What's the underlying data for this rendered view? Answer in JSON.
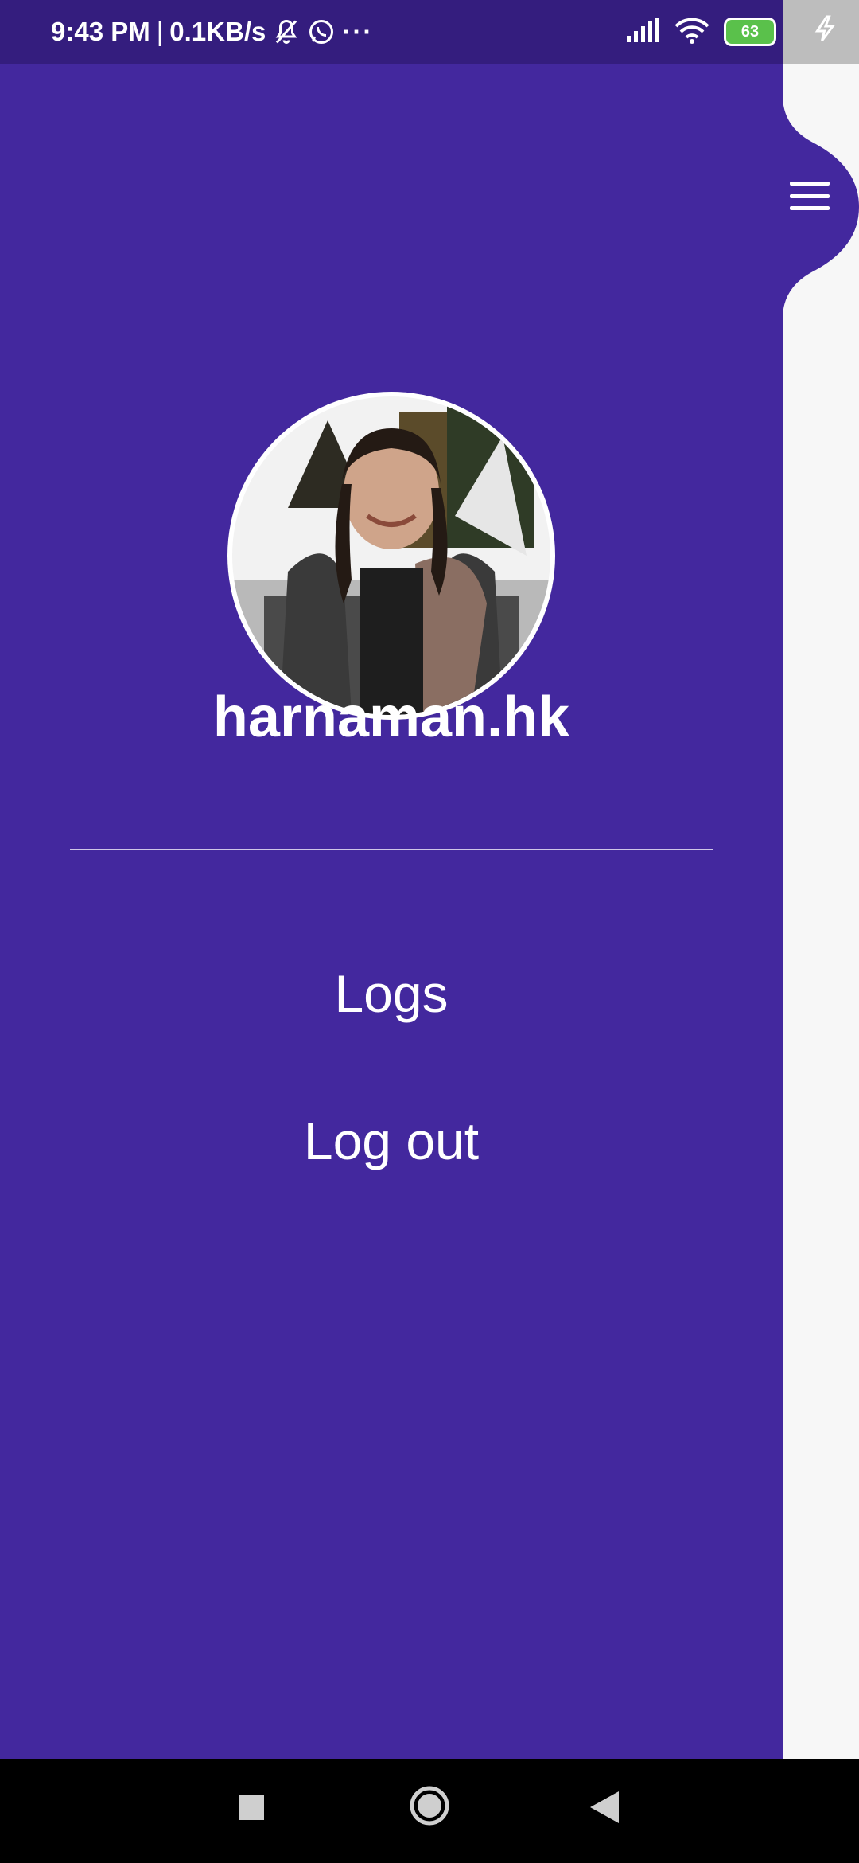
{
  "status_bar": {
    "time": "9:43 PM",
    "speed": "0.1KB/s",
    "separator": "|",
    "more": "···",
    "battery": "63",
    "icons": [
      "bell-off-icon",
      "whatsapp-icon",
      "signal-icon",
      "wifi-icon",
      "battery-icon",
      "charging-icon"
    ]
  },
  "drawer": {
    "username": "harnaman.hk",
    "menu": [
      {
        "label": "Logs"
      },
      {
        "label": "Log out"
      }
    ]
  },
  "colors": {
    "drawer": "#43289e",
    "status_bar": "#341d7e",
    "background": "#f7f7f7"
  },
  "nav": {
    "icons": [
      "recents-icon",
      "home-icon",
      "back-icon"
    ]
  }
}
